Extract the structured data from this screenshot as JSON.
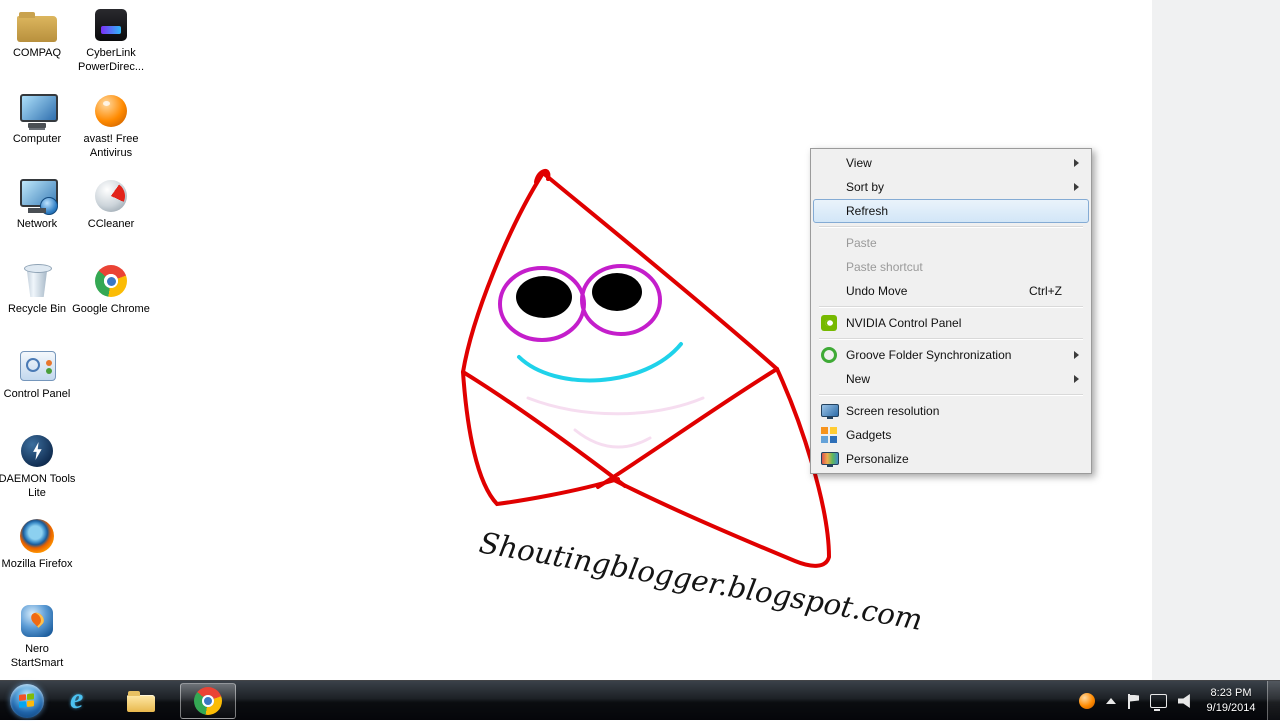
{
  "desktop": {
    "watermark": "Shoutingblogger.blogspot.com",
    "icons": {
      "col1": [
        {
          "label": "COMPAQ"
        },
        {
          "label": "Computer"
        },
        {
          "label": "Network"
        },
        {
          "label": "Recycle Bin"
        },
        {
          "label": "Control Panel"
        },
        {
          "label": "DAEMON Tools Lite"
        },
        {
          "label": "Mozilla Firefox"
        },
        {
          "label": "Nero StartSmart"
        }
      ],
      "col2": [
        {
          "label": "CyberLink PowerDirec..."
        },
        {
          "label": "avast! Free Antivirus"
        },
        {
          "label": "CCleaner"
        },
        {
          "label": "Google Chrome"
        }
      ]
    }
  },
  "context_menu": {
    "items": [
      {
        "label": "View",
        "has_submenu": true
      },
      {
        "label": "Sort by",
        "has_submenu": true
      },
      {
        "label": "Refresh",
        "selected": true
      },
      {
        "label": "Paste",
        "disabled": true
      },
      {
        "label": "Paste shortcut",
        "disabled": true
      },
      {
        "label": "Undo Move",
        "shortcut": "Ctrl+Z"
      },
      {
        "label": "NVIDIA Control Panel",
        "icon": "nvidia-icon"
      },
      {
        "label": "Groove Folder Synchronization",
        "icon": "groove-icon",
        "has_submenu": true
      },
      {
        "label": "New",
        "has_submenu": true
      },
      {
        "label": "Screen resolution",
        "icon": "screen-resolution-icon"
      },
      {
        "label": "Gadgets",
        "icon": "gadgets-icon"
      },
      {
        "label": "Personalize",
        "icon": "personalize-icon"
      }
    ]
  },
  "taskbar": {
    "clock": {
      "time": "8:23 PM",
      "date": "9/19/2014"
    }
  }
}
